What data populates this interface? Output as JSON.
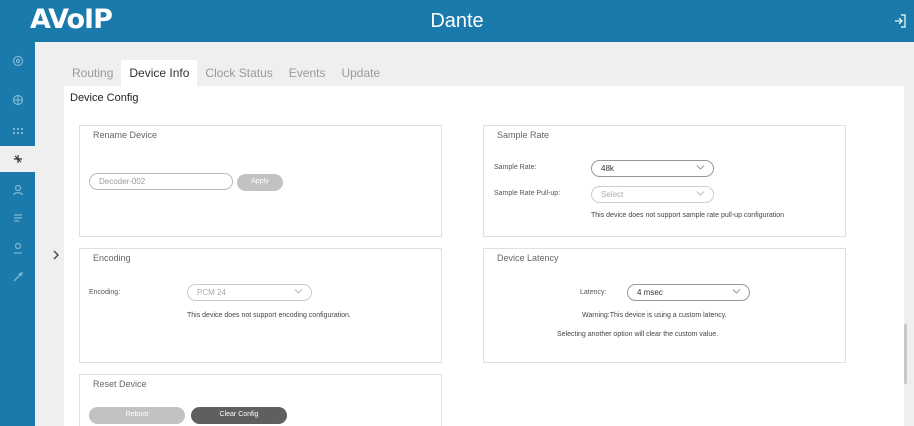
{
  "header": {
    "logo": "AVoIP",
    "title": "Dante"
  },
  "tabs": [
    "Routing",
    "Device Info",
    "Clock Status",
    "Events",
    "Update"
  ],
  "active_tab": "Device Info",
  "page_title": "Device Config",
  "rename_device": {
    "title": "Rename Device",
    "placeholder": "Decoder-002",
    "apply_label": "Apply"
  },
  "sample_rate": {
    "title": "Sample Rate",
    "rate_label": "Sample Rate:",
    "rate_value": "48k",
    "pullup_label": "Sample Rate Pull-up:",
    "pullup_value": "Select",
    "note": "This device does not support sample rate pull-up configuration"
  },
  "encoding": {
    "title": "Encoding",
    "label": "Encoding:",
    "value": "PCM 24",
    "note": "This device does not support encoding configuration."
  },
  "device_latency": {
    "title": "Device Latency",
    "label": "Latency:",
    "value": "4 msec",
    "warning": "Warning:This device is using a custom latency.",
    "note": "Selecting another option will clear the custom value."
  },
  "reset_device": {
    "title": "Reset Device",
    "reboot_label": "Reboot",
    "clear_label": "Clear Config"
  },
  "sidebar_icons": [
    "status-icon",
    "network-icon",
    "matrix-icon",
    "dante-icon",
    "user-icon",
    "settings-icon",
    "profile-icon",
    "tools-icon"
  ],
  "colors": {
    "header": "#1a7aab",
    "background": "#efefef",
    "disabled_button": "#c2c2c2",
    "dark_button": "#5f5f5f"
  }
}
